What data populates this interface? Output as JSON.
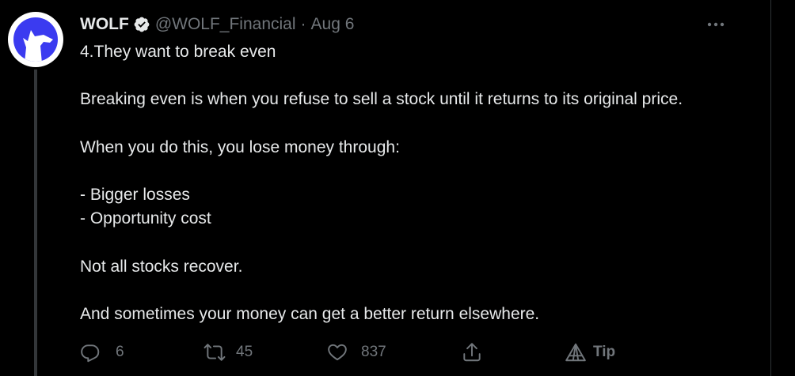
{
  "tweet": {
    "author": {
      "display_name": "WOLF",
      "handle": "@WOLF_Financial",
      "verified": true,
      "avatar_icon": "wolf-logo-icon"
    },
    "separator": "·",
    "date": "Aug 6",
    "body_lines": [
      "4.They want to break even",
      "",
      "Breaking even is when you refuse to sell a stock until it returns to its original price.",
      "",
      "When you do this, you lose money through:",
      "",
      "- Bigger losses",
      "- Opportunity cost",
      "",
      "Not all stocks recover.",
      "",
      "And sometimes your money can get a better return elsewhere."
    ],
    "actions": {
      "reply_count": "6",
      "retweet_count": "45",
      "like_count": "837",
      "tip_label": "Tip"
    }
  },
  "colors": {
    "background": "#000000",
    "text_primary": "#e7e9ea",
    "text_secondary": "#71767b",
    "avatar_bg": "#3b3bf0",
    "thread_line": "#333639"
  }
}
